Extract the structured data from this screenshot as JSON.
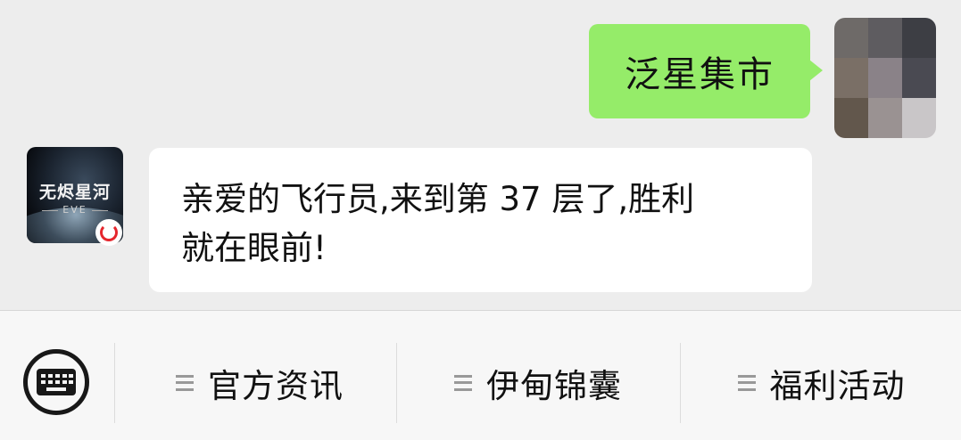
{
  "chat": {
    "outgoing_message": "泛星集市",
    "incoming_message_line1": "亲爱的飞行员,来到第 37 层了,胜利",
    "incoming_message_line2": "就在眼前!",
    "bot_avatar": {
      "logo_cn": "无烬星河",
      "logo_en": "EVE",
      "badge_icon": "netease-icon"
    },
    "user_avatar_icon": "pixelated-avatar"
  },
  "input_bar": {
    "keyboard_icon": "keyboard-icon",
    "menu": [
      {
        "label": "官方资讯",
        "icon": "menu-lines-icon"
      },
      {
        "label": "伊甸锦囊",
        "icon": "menu-lines-icon"
      },
      {
        "label": "福利活动",
        "icon": "menu-lines-icon"
      }
    ]
  },
  "colors": {
    "background": "#ededed",
    "outgoing_bubble": "#95ec69",
    "incoming_bubble": "#ffffff",
    "input_bar": "#f7f7f7"
  }
}
